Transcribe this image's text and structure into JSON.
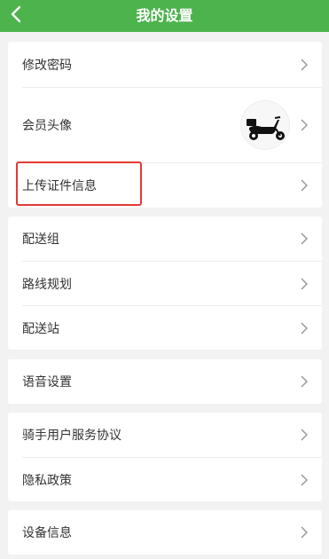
{
  "header": {
    "title": "我的设置",
    "back_icon": "chevron-left-icon",
    "bg_color": "#4db34d"
  },
  "groups": [
    {
      "items": [
        {
          "label": "修改密码"
        },
        {
          "label": "会员头像",
          "avatar": "scooter-avatar"
        },
        {
          "label": "上传证件信息",
          "highlighted": true
        }
      ]
    },
    {
      "items": [
        {
          "label": "配送组"
        },
        {
          "label": "路线规划"
        },
        {
          "label": "配送站"
        }
      ]
    },
    {
      "items": [
        {
          "label": "语音设置"
        }
      ]
    },
    {
      "items": [
        {
          "label": "骑手用户服务协议"
        },
        {
          "label": "隐私政策"
        }
      ]
    },
    {
      "items": [
        {
          "label": "设备信息"
        }
      ]
    }
  ],
  "colors": {
    "highlight_border": "#e53935",
    "chevron": "#999999"
  }
}
